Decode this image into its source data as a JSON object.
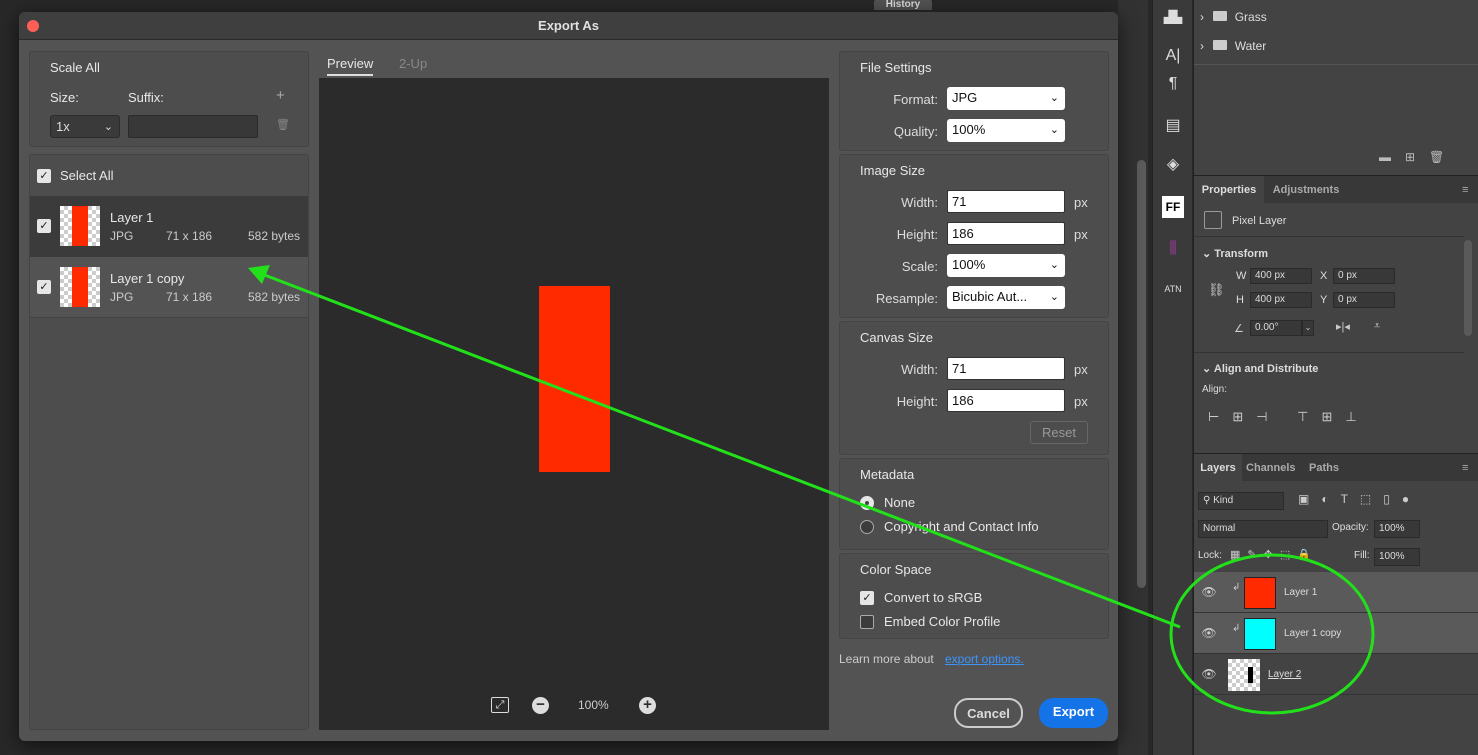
{
  "dialog": {
    "title": "Export As",
    "left": {
      "scale_all": "Scale All",
      "size_label": "Size:",
      "suffix_label": "Suffix:",
      "size_value": "1x",
      "suffix_value": "",
      "select_all": "Select All",
      "assets": [
        {
          "name": "Layer 1",
          "format": "JPG",
          "dims": "71 x 186",
          "size": "582 bytes",
          "checked": true
        },
        {
          "name": "Layer 1 copy",
          "format": "JPG",
          "dims": "71 x 186",
          "size": "582 bytes",
          "checked": true
        }
      ]
    },
    "preview": {
      "tab_preview": "Preview",
      "tab_2up": "2-Up",
      "zoom": "100%"
    },
    "file_settings": {
      "title": "File Settings",
      "format_label": "Format:",
      "format_value": "JPG",
      "quality_label": "Quality:",
      "quality_value": "100%"
    },
    "image_size": {
      "title": "Image Size",
      "width_label": "Width:",
      "width_value": "71",
      "height_label": "Height:",
      "height_value": "186",
      "scale_label": "Scale:",
      "scale_value": "100%",
      "resample_label": "Resample:",
      "resample_value": "Bicubic Aut...",
      "unit": "px"
    },
    "canvas_size": {
      "title": "Canvas Size",
      "width_label": "Width:",
      "width_value": "71",
      "height_label": "Height:",
      "height_value": "186",
      "unit": "px",
      "reset": "Reset"
    },
    "metadata": {
      "title": "Metadata",
      "option_none": "None",
      "option_copyright": "Copyright and Contact Info"
    },
    "color_space": {
      "title": "Color Space",
      "convert": "Convert to sRGB",
      "embed": "Embed Color Profile"
    },
    "learn_more": "Learn more about",
    "learn_link": "export options.",
    "cancel": "Cancel",
    "export": "Export"
  },
  "background": {
    "history_tab": "History",
    "folders": [
      "Grass",
      "Water"
    ],
    "properties_tab": "Properties",
    "adjustments_tab": "Adjustments",
    "pixel_layer": "Pixel Layer",
    "transform": "Transform",
    "w_label": "W",
    "w_value": "400 px",
    "h_label": "H",
    "h_value": "400 px",
    "x_label": "X",
    "x_value": "0 px",
    "y_label": "Y",
    "y_value": "0 px",
    "angle": "0.00°",
    "align_distribute": "Align and Distribute",
    "align_label": "Align:",
    "layers_tab": "Layers",
    "channels_tab": "Channels",
    "paths_tab": "Paths",
    "kind": "Kind",
    "blend_mode": "Normal",
    "opacity_label": "Opacity:",
    "opacity_value": "100%",
    "lock_label": "Lock:",
    "fill_label": "Fill:",
    "fill_value": "100%",
    "layers": [
      "Layer 1",
      "Layer 1 copy",
      "Layer 2"
    ]
  },
  "colors": {
    "accent_blue": "#1473e6",
    "annotation_green": "#22e01a",
    "preview_red": "#ff2a00",
    "cyan": "#00ffff"
  }
}
